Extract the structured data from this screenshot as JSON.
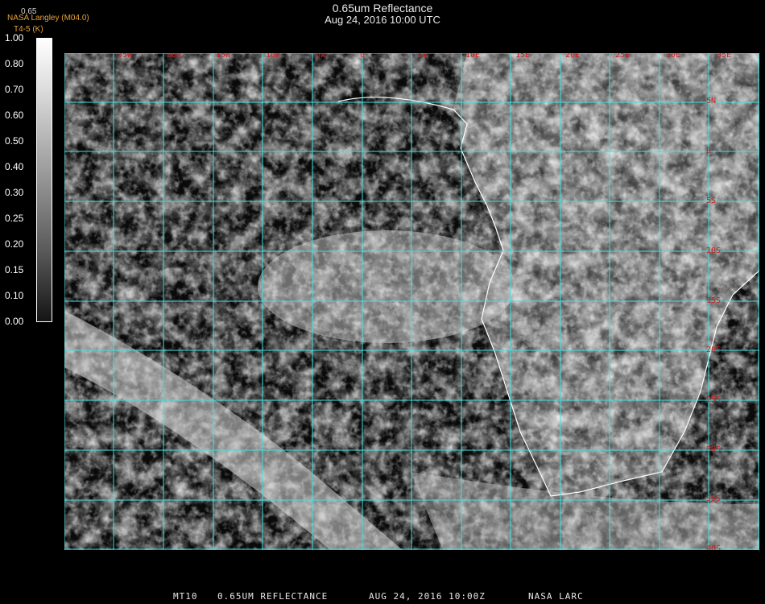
{
  "header": {
    "title": "0.65um Reflectance",
    "subtitle": "Aug 24, 2016 10:00 UTC",
    "source": "NASA Langley (M04.0)",
    "channel": "T4-5 (K)",
    "overlap_label": "0.65"
  },
  "colorbar": {
    "ticks": [
      "1.00",
      "0.80",
      "0.70",
      "0.60",
      "0.50",
      "0.40",
      "0.30",
      "0.25",
      "0.20",
      "0.15",
      "0.10",
      "0.00"
    ]
  },
  "map": {
    "lon_labels": [
      "35W",
      "20W",
      "15W",
      "10W",
      "5W",
      "0",
      "5E",
      "10E",
      "15E",
      "20E",
      "25E",
      "30E",
      "35E"
    ],
    "lat_labels": [
      "5N",
      "0",
      "5S",
      "10S",
      "15S",
      "20S",
      "25S",
      "30S",
      "35S",
      "40S"
    ],
    "grid_color": "#40e0e0",
    "label_color": "#cc2222",
    "coast_color": "#ffffff"
  },
  "footer": {
    "product": "MT10",
    "product_name": "0.65UM REFLECTANCE",
    "datetime": "AUG 24, 2016 10:00Z",
    "agency": "NASA LARC"
  }
}
